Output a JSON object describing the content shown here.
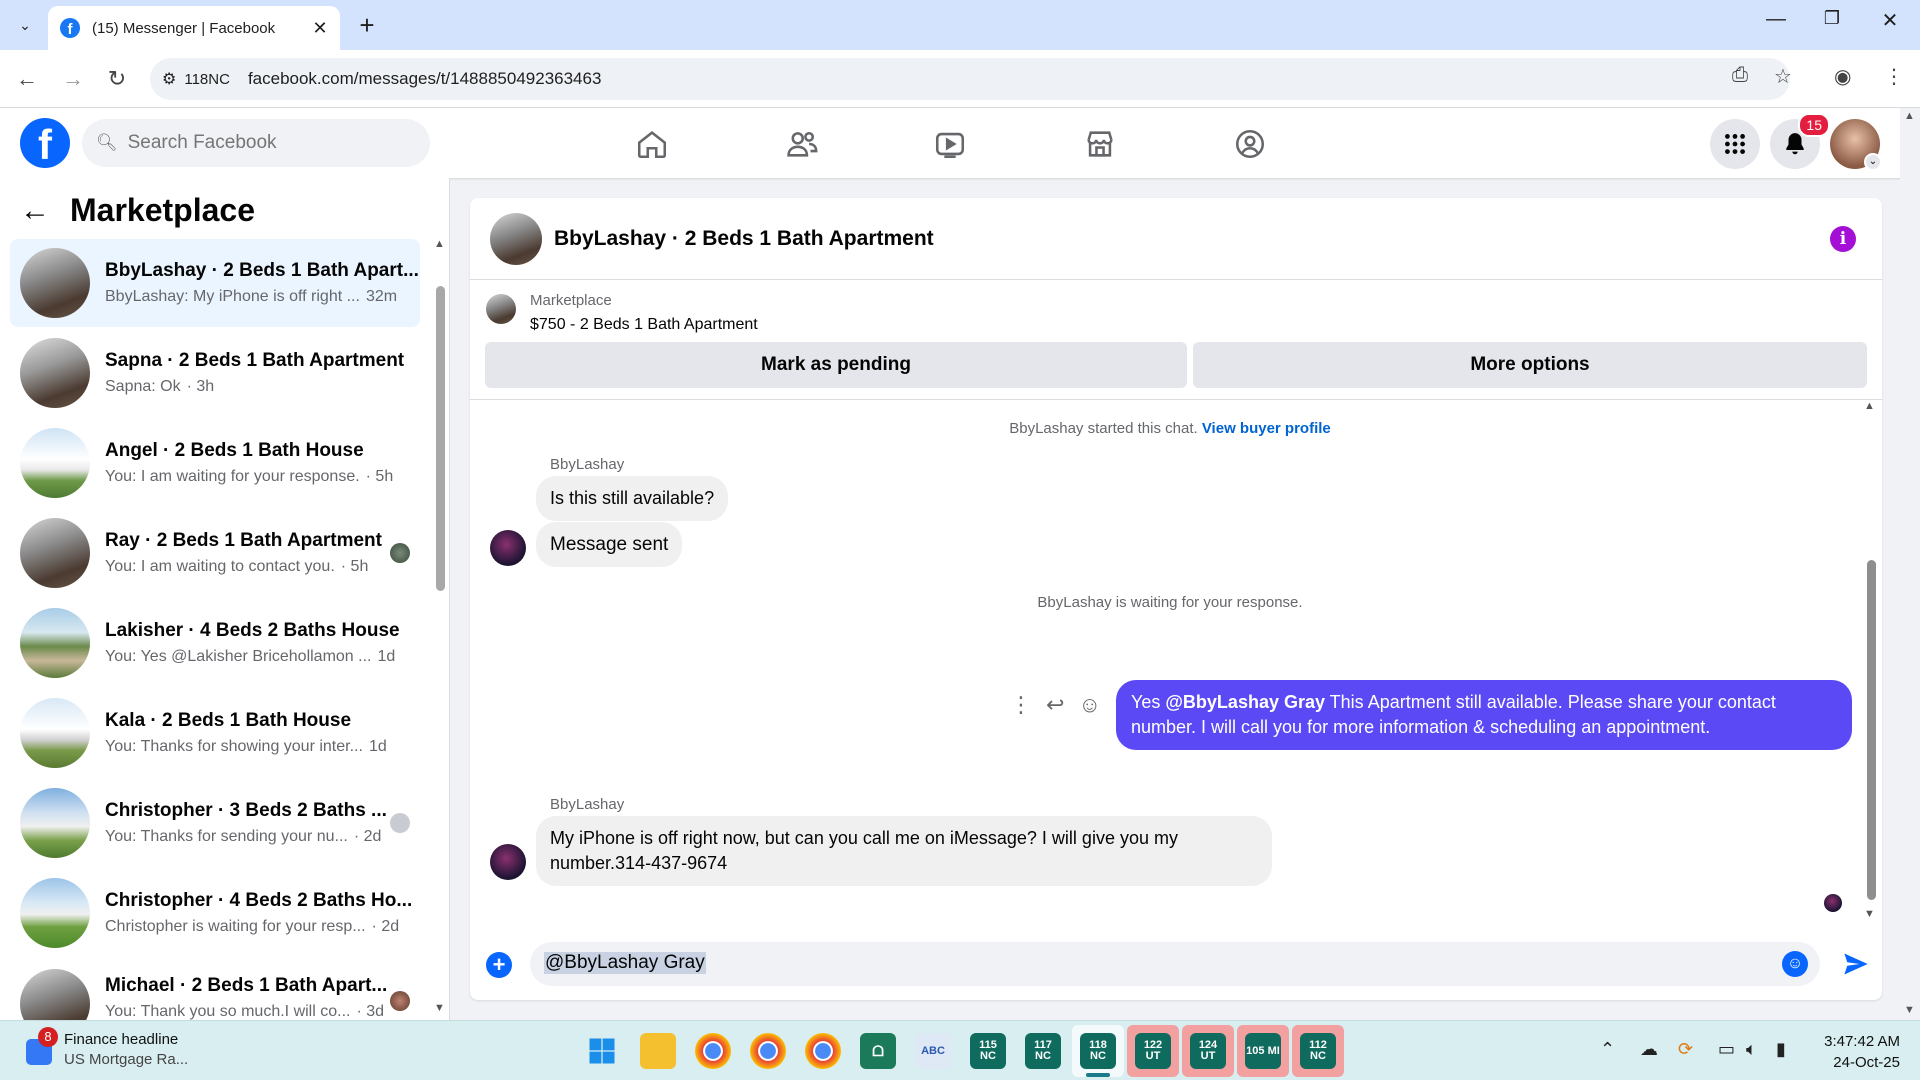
{
  "browser": {
    "tab_title": "(15) Messenger | Facebook",
    "site_badge": "118NC",
    "url": "facebook.com/messages/t/1488850492363463"
  },
  "fb": {
    "search_placeholder": "Search Facebook",
    "notification_count": "15"
  },
  "sidebar": {
    "title": "Marketplace",
    "conversations": [
      {
        "name": "BbyLashay · 2 Beds 1 Bath Apart...",
        "preview": "BbyLashay: My iPhone is off right ...",
        "time": "32m",
        "active": true
      },
      {
        "name": "Sapna · 2 Beds 1 Bath Apartment",
        "preview": "Sapna: Ok",
        "time": "· 3h"
      },
      {
        "name": "Angel · 2 Beds 1 Bath House",
        "preview": "You: I am waiting for your response.",
        "time": "· 5h"
      },
      {
        "name": "Ray · 2 Beds 1 Bath Apartment",
        "preview": "You: I am waiting to contact you.",
        "time": "· 5h"
      },
      {
        "name": "Lakisher · 4 Beds 2 Baths House",
        "preview": "You: Yes @Lakisher Bricehollamon ...",
        "time": "1d"
      },
      {
        "name": "Kala · 2 Beds 1 Bath House",
        "preview": "You: Thanks for showing your inter...",
        "time": "1d"
      },
      {
        "name": "Christopher · 3 Beds 2 Baths ...",
        "preview": "You: Thanks for sending your nu...",
        "time": "· 2d"
      },
      {
        "name": "Christopher · 4 Beds 2 Baths Ho...",
        "preview": "Christopher is waiting for your resp...",
        "time": "· 2d"
      },
      {
        "name": "Michael · 2 Beds 1 Bath Apart...",
        "preview": "You: Thank you so much.I will co...",
        "time": "· 3d"
      }
    ]
  },
  "chat": {
    "title": "BbyLashay · 2 Beds 1 Bath Apartment",
    "listing_source": "Marketplace",
    "listing_price_title": "$750 - 2 Beds 1 Bath Apartment",
    "mark_pending_label": "Mark as pending",
    "more_options_label": "More options",
    "started_text": "BbyLashay started this chat.",
    "view_profile_link": "View buyer profile",
    "sender_name": "BbyLashay",
    "msg1": "Is this still available?",
    "msg2": "Message sent",
    "waiting_text": "BbyLashay is waiting for your response.",
    "out_prefix": "Yes ",
    "out_mention": "@BbyLashay Gray",
    "out_rest": " This Apartment still available. Please share your contact number. I will call you for more information & scheduling an appointment.",
    "sender_name2": "BbyLashay",
    "msg3": "My iPhone is off right now, but can you call me on iMessage? I will give you my number.314-437-9674",
    "composer_value": "@BbyLashay Gray"
  },
  "taskbar": {
    "news_badge": "8",
    "news_title": "Finance headline",
    "news_sub": "US Mortgage Ra...",
    "apps": [
      "115 NC",
      "117 NC",
      "118 NC",
      "122 UT",
      "124 UT",
      "105 MI",
      "112 NC"
    ],
    "time": "3:47:42 AM",
    "date": "24-Oct-25"
  }
}
